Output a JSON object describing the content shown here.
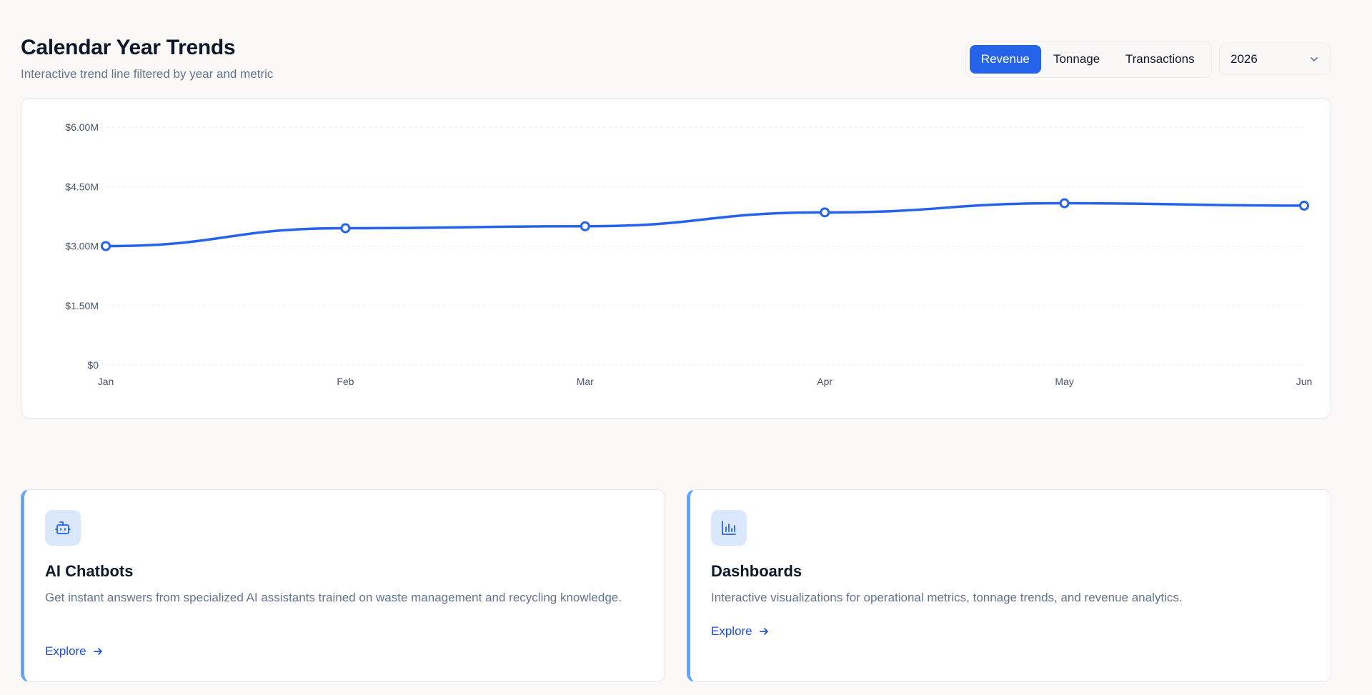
{
  "header": {
    "title": "Calendar Year Trends",
    "subtitle": "Interactive trend line filtered by year and metric"
  },
  "metric_toggle": {
    "options": [
      "Revenue",
      "Tonnage",
      "Transactions"
    ],
    "selected": "Revenue"
  },
  "year_select": {
    "value": "2026",
    "icon": "chevron-down-icon"
  },
  "colors": {
    "accent": "#2563eb",
    "line": "#2563eb",
    "card_border_accent": "#60a5fa",
    "icon_bg": "#dbe7fb",
    "link": "#1d4ed8"
  },
  "chart_data": {
    "type": "line",
    "categories": [
      "Jan",
      "Feb",
      "Mar",
      "Apr",
      "May",
      "Jun"
    ],
    "series": [
      {
        "values": [
          3.0,
          3.45,
          3.5,
          3.85,
          4.08,
          4.02
        ]
      }
    ],
    "ylim": [
      0,
      6.0
    ],
    "yticks": [
      0,
      1.5,
      3.0,
      4.5,
      6.0
    ],
    "ytick_labels": [
      "$0",
      "$1.50M",
      "$3.00M",
      "$4.50M",
      "$6.00M"
    ],
    "unit": "$M",
    "grid": true,
    "legend": "none"
  },
  "cards": [
    {
      "icon": "bot-icon",
      "title": "AI Chatbots",
      "description": "Get instant answers from specialized AI assistants trained on waste management and recycling knowledge.",
      "link": "Explore"
    },
    {
      "icon": "bar-chart-icon",
      "title": "Dashboards",
      "description": "Interactive visualizations for operational metrics, tonnage trends, and revenue analytics.",
      "link": "Explore"
    }
  ]
}
